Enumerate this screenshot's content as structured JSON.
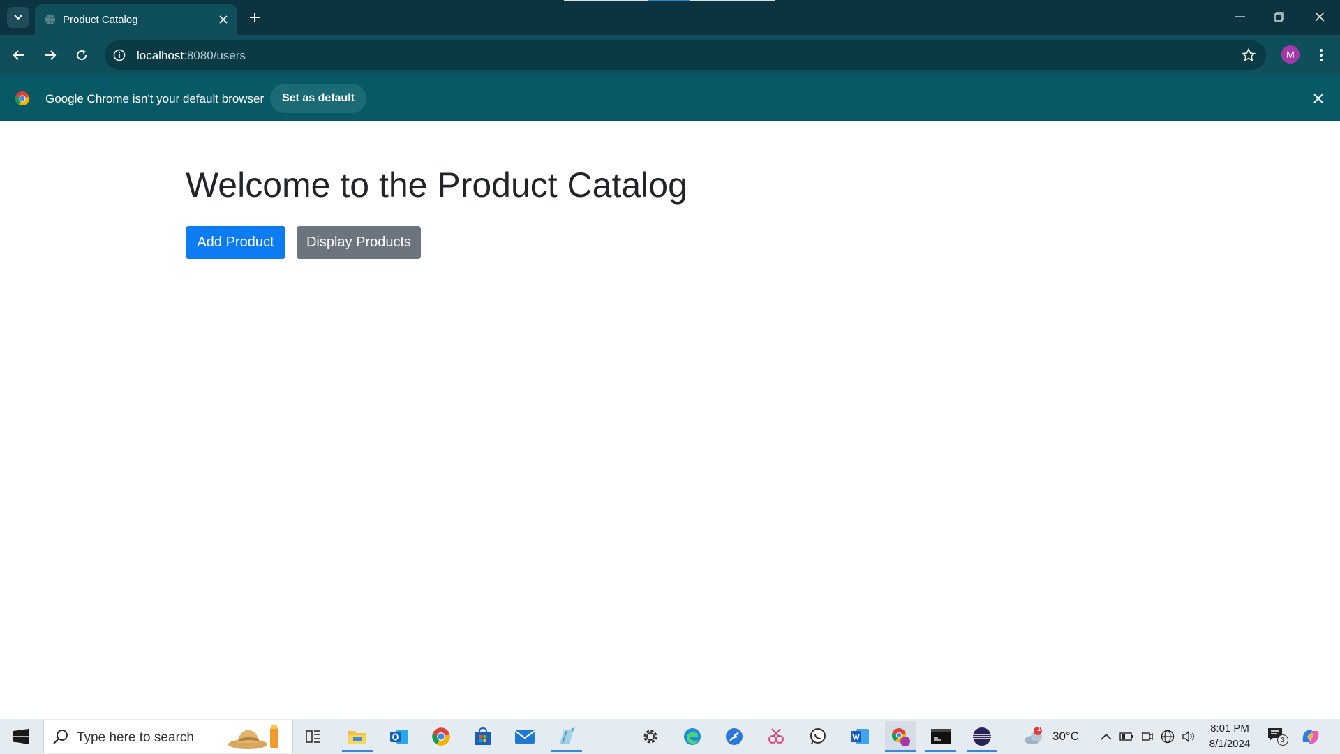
{
  "browser": {
    "tab_title": "Product Catalog",
    "url_host": "localhost",
    "url_rest": ":8080/users",
    "profile_initial": "M"
  },
  "infobar": {
    "message": "Google Chrome isn't your default browser",
    "action_label": "Set as default"
  },
  "page": {
    "heading": "Welcome to the Product Catalog",
    "add_product_label": "Add Product",
    "display_products_label": "Display Products"
  },
  "taskbar": {
    "search_placeholder": "Type here to search",
    "weather_temp": "30°C",
    "time": "8:01 PM",
    "date": "8/1/2024",
    "notification_count": "3",
    "weather_badge": "1"
  },
  "colors": {
    "tabstrip_bg": "#0b3440",
    "toolbar_bg": "#0f4f5b",
    "infobar_bg": "#075a65",
    "primary_button": "#0d7bf2",
    "secondary_button": "#6c757d",
    "heading_text": "#212529",
    "taskbar_bg": "#e4ebf1"
  },
  "icons": [
    "tab-search-icon",
    "globe-icon",
    "close-icon",
    "plus-icon",
    "minimize-icon",
    "restore-icon",
    "back-arrow-icon",
    "forward-arrow-icon",
    "reload-icon",
    "info-icon",
    "star-icon",
    "kebab-menu-icon",
    "chrome-logo-icon",
    "windows-start-icon",
    "search-icon",
    "task-view-icon",
    "file-explorer-icon",
    "outlook-icon",
    "chrome-icon",
    "store-icon",
    "mail-icon",
    "notepad-icon",
    "settings-icon",
    "edge-icon",
    "feather-icon",
    "snipping-tool-icon",
    "whatsapp-icon",
    "word-icon",
    "chrome-profile-icon",
    "mysql-icon",
    "eclipse-icon",
    "weather-icon",
    "chevron-up-icon",
    "battery-icon",
    "meet-icon",
    "network-icon",
    "volume-icon",
    "notification-icon",
    "copilot-icon"
  ]
}
